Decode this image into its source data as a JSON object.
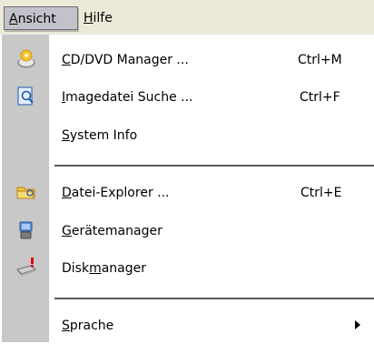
{
  "colors": {
    "menubar_bg": "#ece9d8",
    "active_bg": "#c2c2cb",
    "icon_strip": "#c8c8c8"
  },
  "menubar": {
    "ansicht": {
      "pre": "",
      "mnemonic": "A",
      "post": "nsicht"
    },
    "hilfe": {
      "pre": "",
      "mnemonic": "H",
      "post": "ilfe"
    }
  },
  "menu": {
    "cd_dvd": {
      "pre": "",
      "mnemonic": "C",
      "post": "D/DVD Manager ...",
      "shortcut": "Ctrl+M",
      "icon": "cd-dvd-icon"
    },
    "image_search": {
      "pre": "",
      "mnemonic": "I",
      "post": "magedatei Suche ...",
      "shortcut": "Ctrl+F",
      "icon": "image-search-icon"
    },
    "system_info": {
      "pre": "",
      "mnemonic": "S",
      "post": "ystem Info"
    },
    "explorer": {
      "pre": "",
      "mnemonic": "D",
      "post": "atei-Explorer ...",
      "shortcut": "Ctrl+E",
      "icon": "folder-explorer-icon"
    },
    "device_manager": {
      "pre": "",
      "mnemonic": "G",
      "post": "erätemanager",
      "icon": "device-manager-icon"
    },
    "disk_manager": {
      "pre": "Disk",
      "mnemonic": "m",
      "post": "anager",
      "icon": "disk-manager-icon"
    },
    "language": {
      "pre": "",
      "mnemonic": "S",
      "post": "prache",
      "submenu": true
    }
  }
}
